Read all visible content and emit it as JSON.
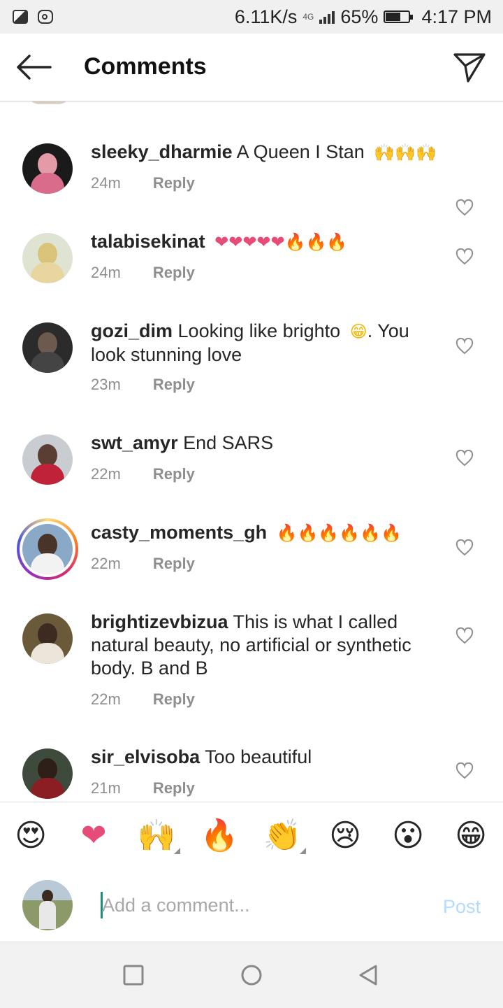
{
  "status_bar": {
    "speed": "6.11K/s",
    "network": "4G",
    "battery": "65%",
    "time": "4:17 PM"
  },
  "header": {
    "title": "Comments"
  },
  "comments": [
    {
      "user": "sleeky_dharmie",
      "text": "A Queen I Stan",
      "emoji": "🙌🙌🙌",
      "time": "24m",
      "reply": "Reply"
    },
    {
      "user": "talabisekinat",
      "text": "",
      "emoji": "❤❤❤❤❤🔥🔥🔥",
      "time": "24m",
      "reply": "Reply"
    },
    {
      "user": "gozi_dim",
      "text": "Looking like brighto",
      "emoji": "😁",
      "text2": ". You look stunning love",
      "time": "23m",
      "reply": "Reply"
    },
    {
      "user": "swt_amyr",
      "text": "End SARS",
      "emoji": "",
      "time": "22m",
      "reply": "Reply"
    },
    {
      "user": "casty_moments_gh",
      "text": "",
      "emoji": "🔥🔥🔥🔥🔥🔥",
      "time": "22m",
      "reply": "Reply"
    },
    {
      "user": "brightizevbizua",
      "text": "This is what I called natural beauty, no artificial or synthetic body. B and B",
      "emoji": "",
      "time": "22m",
      "reply": "Reply"
    },
    {
      "user": "sir_elvisoba",
      "text": "Too beautiful",
      "emoji": "",
      "time": "21m",
      "reply": "Reply"
    }
  ],
  "emoji_bar": [
    "😍",
    "❤",
    "🙌",
    "🔥",
    "👏",
    "😢",
    "😮",
    "😁"
  ],
  "composer": {
    "placeholder": "Add a comment...",
    "post_label": "Post"
  },
  "colors": {
    "accent_post": "#b3dbff",
    "meta_grey": "#8e8e8e",
    "heart": "#e74c78",
    "fire": "#f4511e"
  }
}
